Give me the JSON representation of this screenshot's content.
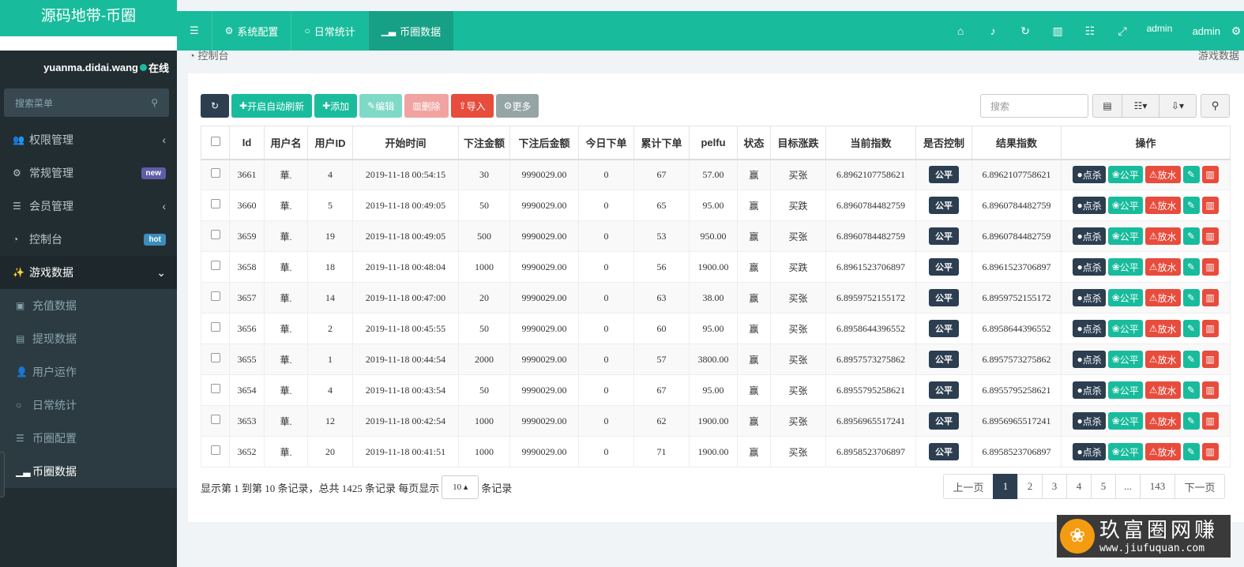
{
  "app": {
    "title": "源码地带-币圈"
  },
  "user": {
    "name": "yuanma.didai.wang",
    "status": "在线"
  },
  "sidebar": {
    "search_placeholder": "搜索菜单",
    "items": [
      {
        "label": "权限管理",
        "icon": "users-icon"
      },
      {
        "label": "常规管理",
        "icon": "cogs-icon",
        "badge": "new"
      },
      {
        "label": "会员管理",
        "icon": "list-icon"
      },
      {
        "label": "控制台",
        "icon": "dashboard-icon",
        "badge": "hot"
      },
      {
        "label": "游戏数据",
        "icon": "magic-icon"
      }
    ],
    "sub_items": [
      {
        "label": "充值数据"
      },
      {
        "label": "提现数据"
      },
      {
        "label": "用户运作"
      },
      {
        "label": "日常统计"
      },
      {
        "label": "币圈配置"
      },
      {
        "label": "币圈数据"
      }
    ]
  },
  "header": {
    "tabs": [
      {
        "label": "系统配置"
      },
      {
        "label": "日常统计"
      },
      {
        "label": "币圈数据"
      }
    ],
    "admin_alt": "admin",
    "admin": "admin"
  },
  "breadcrumb": {
    "left": "控制台",
    "right": "游戏数据"
  },
  "toolbar": {
    "auto_refresh": "开启自动刷新",
    "add": "添加",
    "edit": "编辑",
    "delete": "删除",
    "import": "导入",
    "more": "更多",
    "search_placeholder": "搜索"
  },
  "table": {
    "headers": [
      "Id",
      "用户名",
      "用户ID",
      "开始时间",
      "下注金额",
      "下注后金额",
      "今日下单",
      "累计下单",
      "pelfu",
      "状态",
      "目标涨跌",
      "当前指数",
      "是否控制",
      "结果指数",
      "操作"
    ],
    "ops": {
      "kill": "点杀",
      "fair": "公平",
      "release": "放水"
    },
    "rows": [
      [
        "3661",
        "華.",
        "4",
        "2019-11-18 00:54:15",
        "30",
        "9990029.00",
        "0",
        "67",
        "57.00",
        "赢",
        "买张",
        "6.8962107758621",
        "公平",
        "6.8962107758621"
      ],
      [
        "3660",
        "華.",
        "5",
        "2019-11-18 00:49:05",
        "50",
        "9990029.00",
        "0",
        "65",
        "95.00",
        "赢",
        "买跌",
        "6.8960784482759",
        "公平",
        "6.8960784482759"
      ],
      [
        "3659",
        "華.",
        "19",
        "2019-11-18 00:49:05",
        "500",
        "9990029.00",
        "0",
        "53",
        "950.00",
        "赢",
        "买张",
        "6.8960784482759",
        "公平",
        "6.8960784482759"
      ],
      [
        "3658",
        "華.",
        "18",
        "2019-11-18 00:48:04",
        "1000",
        "9990029.00",
        "0",
        "56",
        "1900.00",
        "赢",
        "买跌",
        "6.8961523706897",
        "公平",
        "6.8961523706897"
      ],
      [
        "3657",
        "華.",
        "14",
        "2019-11-18 00:47:00",
        "20",
        "9990029.00",
        "0",
        "63",
        "38.00",
        "赢",
        "买张",
        "6.8959752155172",
        "公平",
        "6.8959752155172"
      ],
      [
        "3656",
        "華.",
        "2",
        "2019-11-18 00:45:55",
        "50",
        "9990029.00",
        "0",
        "60",
        "95.00",
        "赢",
        "买张",
        "6.8958644396552",
        "公平",
        "6.8958644396552"
      ],
      [
        "3655",
        "華.",
        "1",
        "2019-11-18 00:44:54",
        "2000",
        "9990029.00",
        "0",
        "57",
        "3800.00",
        "赢",
        "买张",
        "6.8957573275862",
        "公平",
        "6.8957573275862"
      ],
      [
        "3654",
        "華.",
        "4",
        "2019-11-18 00:43:54",
        "50",
        "9990029.00",
        "0",
        "67",
        "95.00",
        "赢",
        "买张",
        "6.8955795258621",
        "公平",
        "6.8955795258621"
      ],
      [
        "3653",
        "華.",
        "12",
        "2019-11-18 00:42:54",
        "1000",
        "9990029.00",
        "0",
        "62",
        "1900.00",
        "赢",
        "买张",
        "6.8956965517241",
        "公平",
        "6.8956965517241"
      ],
      [
        "3652",
        "華.",
        "20",
        "2019-11-18 00:41:51",
        "1000",
        "9990029.00",
        "0",
        "71",
        "1900.00",
        "赢",
        "买张",
        "6.8958523706897",
        "公平",
        "6.8958523706897"
      ]
    ]
  },
  "pagination": {
    "info_prefix": "显示第 1 到第 10 条记录，总共 1425 条记录 每页显示",
    "page_size": "10",
    "info_suffix": "条记录",
    "prev": "上一页",
    "pages": [
      "1",
      "2",
      "3",
      "4",
      "5",
      "...",
      "143"
    ],
    "next": "下一页"
  },
  "watermark": {
    "title": "玖富圈网赚",
    "url": "www.jiufuquan.com"
  },
  "colors": {
    "primary": "#18bc9c",
    "sidebar": "#222d32",
    "dark": "#2c3e50",
    "danger": "#e74c3c"
  }
}
